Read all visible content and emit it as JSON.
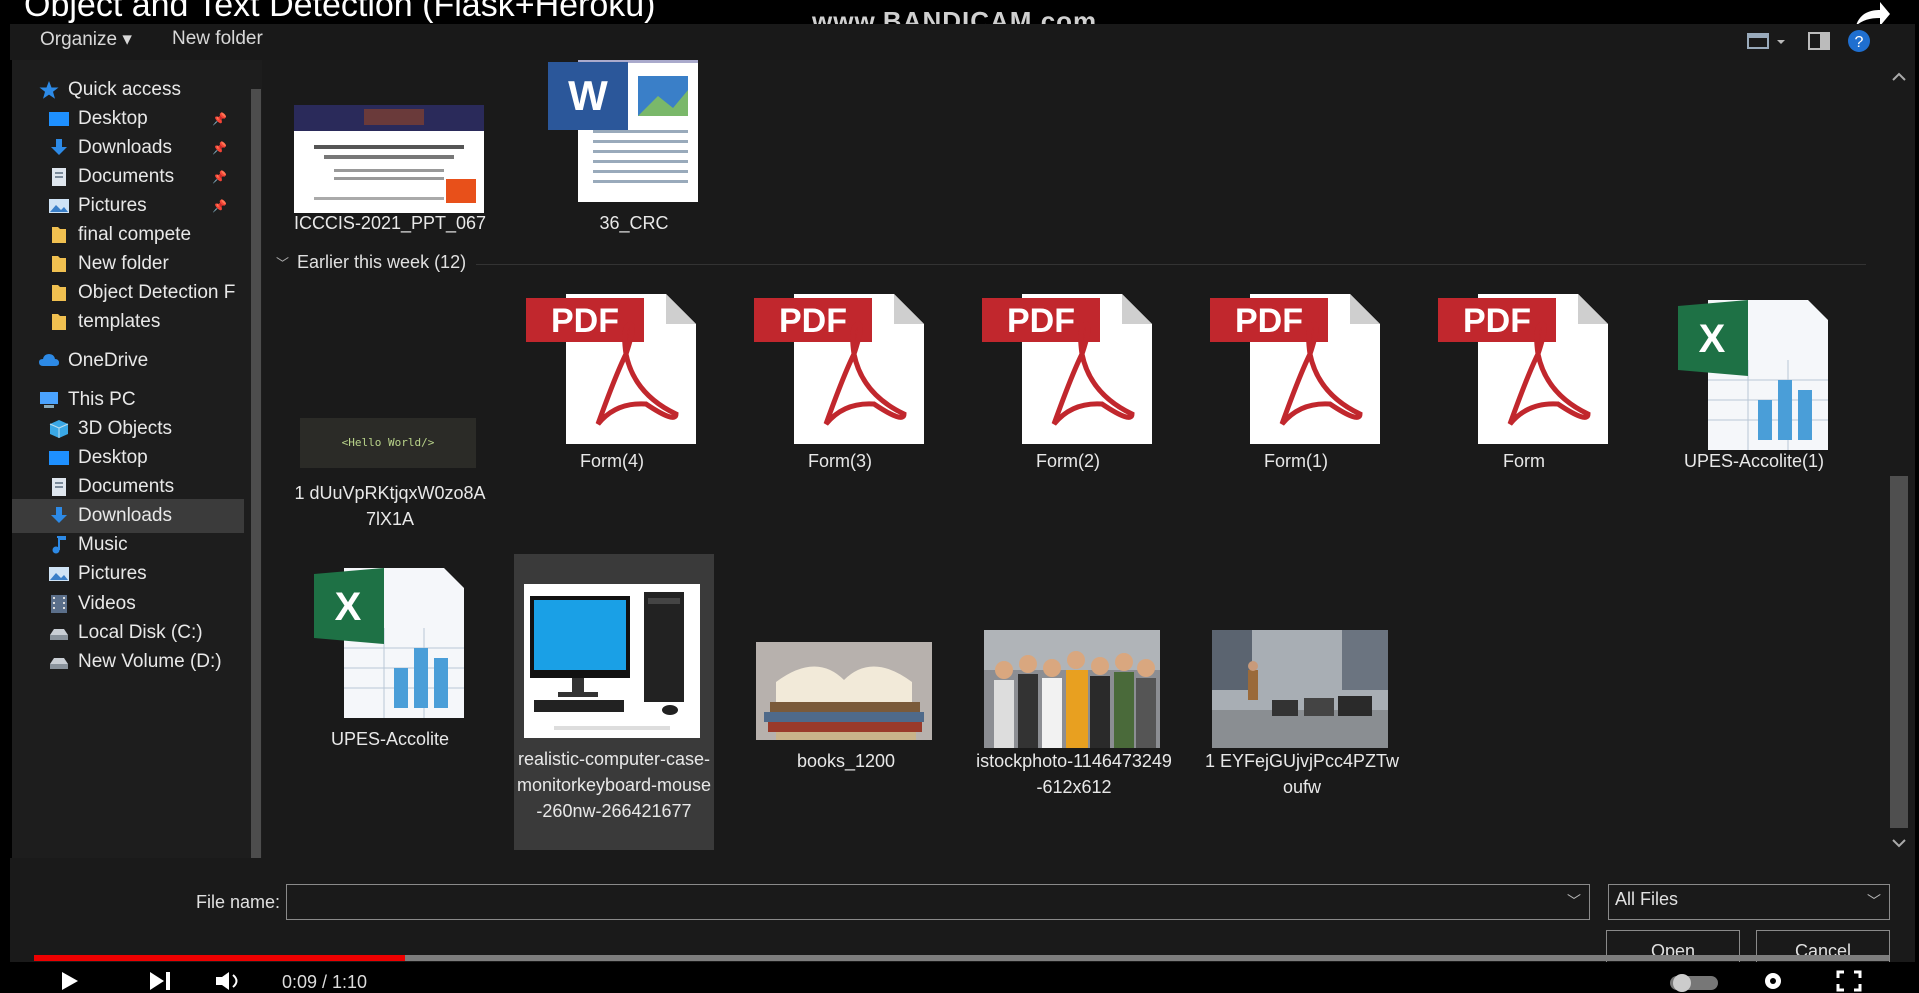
{
  "video": {
    "title": "Object and Text Detection (Flask+Heroku)",
    "watermark": "www.BANDICAM.com",
    "time": "0:09 / 1:10",
    "progress_fraction": 0.2
  },
  "toolbar": {
    "organize": "Organize ▾",
    "new_folder": "New folder"
  },
  "nav": [
    {
      "label": "Quick access",
      "icon": "star-icon",
      "indent": false,
      "pinned": false
    },
    {
      "label": "Desktop",
      "icon": "desktop-folder-icon",
      "indent": true,
      "pinned": true
    },
    {
      "label": "Downloads",
      "icon": "download-arrow-icon",
      "indent": true,
      "pinned": true
    },
    {
      "label": "Documents",
      "icon": "documents-icon",
      "indent": true,
      "pinned": true
    },
    {
      "label": "Pictures",
      "icon": "pictures-icon",
      "indent": true,
      "pinned": true
    },
    {
      "label": "final compete",
      "icon": "folder-icon",
      "indent": true,
      "pinned": false
    },
    {
      "label": "New folder",
      "icon": "folder-icon",
      "indent": true,
      "pinned": false
    },
    {
      "label": "Object Detection F",
      "icon": "folder-icon",
      "indent": true,
      "pinned": false
    },
    {
      "label": "templates",
      "icon": "folder-icon",
      "indent": true,
      "pinned": false
    },
    {
      "label": "OneDrive",
      "icon": "cloud-icon",
      "indent": false,
      "pinned": false
    },
    {
      "label": "This PC",
      "icon": "computer-icon",
      "indent": false,
      "pinned": false
    },
    {
      "label": "3D Objects",
      "icon": "cube-icon",
      "indent": true,
      "pinned": false
    },
    {
      "label": "Desktop",
      "icon": "desktop-folder-icon",
      "indent": true,
      "pinned": false
    },
    {
      "label": "Documents",
      "icon": "documents-icon",
      "indent": true,
      "pinned": false
    },
    {
      "label": "Downloads",
      "icon": "download-arrow-icon",
      "indent": true,
      "pinned": false,
      "active": true
    },
    {
      "label": "Music",
      "icon": "music-note-icon",
      "indent": true,
      "pinned": false
    },
    {
      "label": "Pictures",
      "icon": "pictures-icon",
      "indent": true,
      "pinned": false
    },
    {
      "label": "Videos",
      "icon": "film-icon",
      "indent": true,
      "pinned": false
    },
    {
      "label": "Local Disk (C:)",
      "icon": "drive-icon",
      "indent": true,
      "pinned": false
    },
    {
      "label": "New Volume (D:)",
      "icon": "drive-icon",
      "indent": true,
      "pinned": false
    }
  ],
  "group_header": "Earlier this week (12)",
  "files": {
    "icccis": "ICCCIS-2021_PPT_067",
    "crc": "36_CRC",
    "hello": "1 dUuVpRKtjqxW0zo8A7lX1A",
    "hello_thumb_text": "<Hello World/>",
    "form4": "Form(4)",
    "form3": "Form(3)",
    "form2": "Form(2)",
    "form1": "Form(1)",
    "form": "Form",
    "upes1": "UPES-Accolite(1)",
    "upes": "UPES-Accolite",
    "computer": "realistic-computer-case-monitorkeyboard-mouse-260nw-266421677",
    "books": "books_1200",
    "istock": "istockphoto-1146473249-612x612",
    "street": "1 EYFejGUjvjPcc4PZTwoufw",
    "pdf_badge": "PDF"
  },
  "dialog": {
    "file_name_label": "File name:",
    "file_name_value": "",
    "file_type": "All Files",
    "open": "Open",
    "cancel": "Cancel"
  }
}
